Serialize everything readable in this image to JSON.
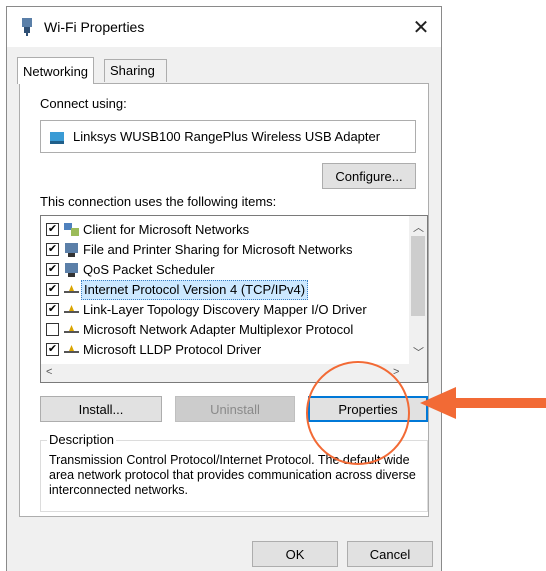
{
  "window": {
    "title": "Wi-Fi Properties",
    "close_glyph": "✕",
    "title_icon": "wifi-adapter-icon"
  },
  "tabs": [
    {
      "label": "Networking",
      "active": true
    },
    {
      "label": "Sharing",
      "active": false
    }
  ],
  "connect_using": {
    "label": "Connect using:",
    "adapter": "Linksys WUSB100 RangePlus Wireless USB Adapter",
    "configure_button": "Configure..."
  },
  "items_section": {
    "label": "This connection uses the following items:",
    "items": [
      {
        "label": "Client for Microsoft Networks",
        "checked": true,
        "icon": "network-client-icon"
      },
      {
        "label": "File and Printer Sharing for Microsoft Networks",
        "checked": true,
        "icon": "computer-icon"
      },
      {
        "label": "QoS Packet Scheduler",
        "checked": true,
        "icon": "computer-icon"
      },
      {
        "label": "Internet Protocol Version 4 (TCP/IPv4)",
        "checked": true,
        "icon": "protocol-icon",
        "selected": true
      },
      {
        "label": "Link-Layer Topology Discovery Mapper I/O Driver",
        "checked": true,
        "icon": "protocol-icon"
      },
      {
        "label": "Microsoft Network Adapter Multiplexor Protocol",
        "checked": false,
        "icon": "protocol-icon"
      },
      {
        "label": "Microsoft LLDP Protocol Driver",
        "checked": true,
        "icon": "protocol-icon"
      }
    ]
  },
  "actions": {
    "install": "Install...",
    "uninstall": "Uninstall",
    "properties": "Properties"
  },
  "description": {
    "title": "Description",
    "text": "Transmission Control Protocol/Internet Protocol. The default wide area network protocol that provides communication across diverse interconnected networks."
  },
  "footer": {
    "ok": "OK",
    "cancel": "Cancel"
  },
  "colors": {
    "annotation": "#f26a35",
    "selection": "#cce8ff",
    "focus_border": "#0078d7"
  }
}
